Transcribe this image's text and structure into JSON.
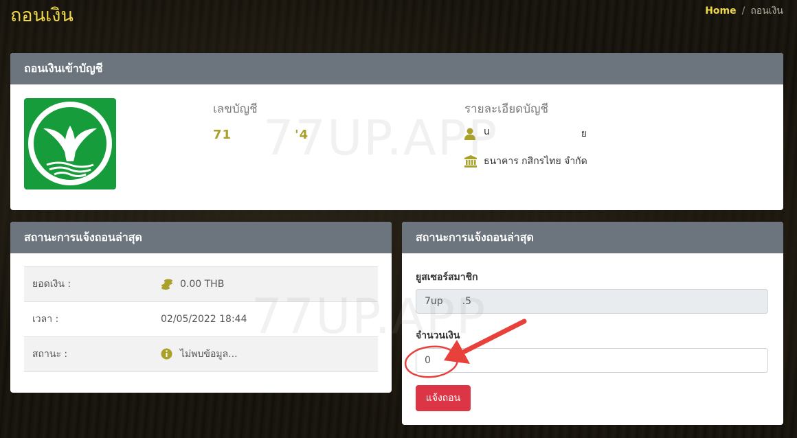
{
  "page": {
    "title": "ถอนเงิน",
    "breadcrumb": {
      "home": "Home",
      "separator": "/",
      "current": "ถอนเงิน"
    }
  },
  "withdraw_account": {
    "header": "ถอนเงินเข้าบัญชี",
    "bank_logo_icon": "kasikorn-bank-logo",
    "account_number_label": "เลขบัญชี",
    "account_number_start": "71",
    "account_number_end": "'4",
    "details_label": "รายละเอียดบัญชี",
    "holder_start": "u",
    "holder_end": "ย",
    "bank_name": "ธนาคาร กสิกรไทย จำกัด"
  },
  "latest_status": {
    "header": "สถานะการแจ้งถอนล่าสุด",
    "rows": [
      {
        "label": "ยอดเงิน :",
        "value": "0.00 THB",
        "icon": "coins-icon"
      },
      {
        "label": "เวลา :",
        "value": "02/05/2022 18:44",
        "icon": ""
      },
      {
        "label": "สถานะ :",
        "value": "ไม่พบข้อมูล...",
        "icon": "info-icon"
      }
    ]
  },
  "withdraw_form": {
    "header": "สถานะการแจ้งถอนล่าสุด",
    "username_label": "ยูสเซอร์สมาชิก",
    "username_start": "7up",
    "username_end": ".5",
    "amount_label": "จำนวนเงิน",
    "amount_value": "0",
    "submit_label": "แจ้งถอน"
  },
  "watermark": "77UP.APP",
  "colors": {
    "accent": "#f0d84a",
    "header": "#6c757d",
    "danger": "#dc3545",
    "annotation": "#e8413c"
  }
}
